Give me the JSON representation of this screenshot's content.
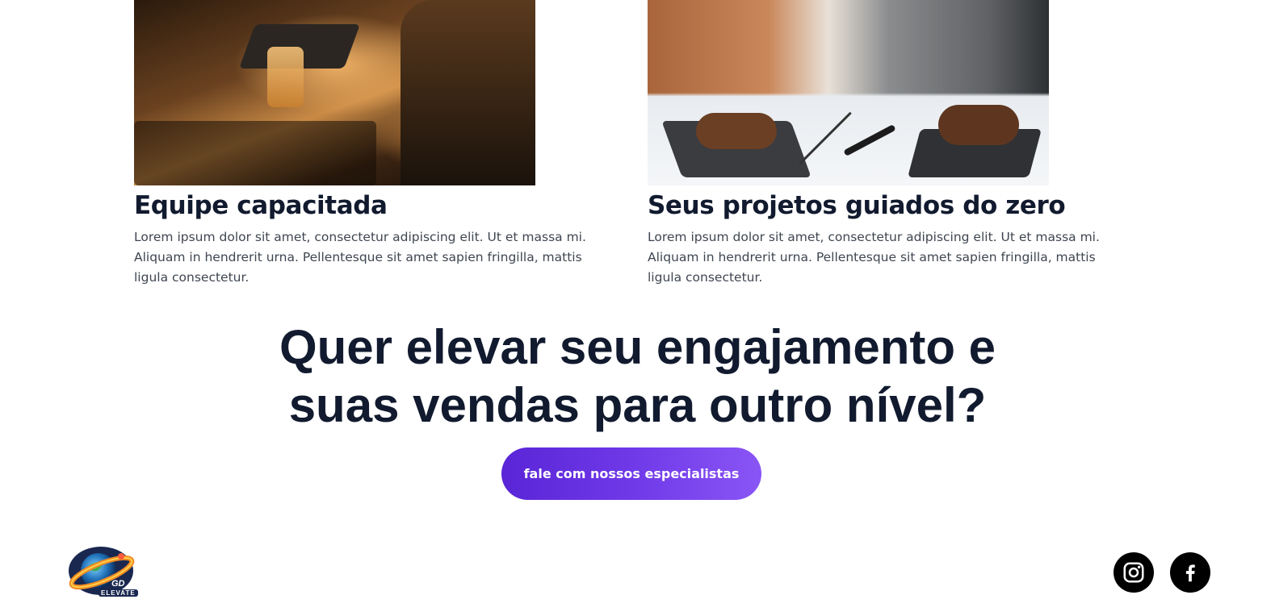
{
  "features": [
    {
      "title": "Equipe capacitada",
      "description": "Lorem ipsum dolor sit amet, consectetur adipiscing elit. Ut et massa mi. Aliquam in hendrerit urna. Pellentesque sit amet sapien fringilla, mattis ligula consectetur."
    },
    {
      "title": "Seus projetos guiados do zero",
      "description": "Lorem ipsum dolor sit amet, consectetur adipiscing elit. Ut et massa mi. Aliquam in hendrerit urna. Pellentesque sit amet sapien fringilla, mattis ligula consectetur."
    }
  ],
  "cta": {
    "title": "Quer elevar seu engajamento e suas vendas para outro nível?",
    "button_label": "fale com nossos especialistas"
  },
  "footer": {
    "logo_text": "ELEVATE",
    "logo_mark": "GD",
    "social": [
      "instagram-icon",
      "facebook-icon"
    ]
  },
  "colors": {
    "heading": "#111a2e",
    "body_text": "#3f4651",
    "button_gradient_start": "#5a25d6",
    "button_gradient_end": "#8a55f5",
    "social_bg": "#000000"
  }
}
